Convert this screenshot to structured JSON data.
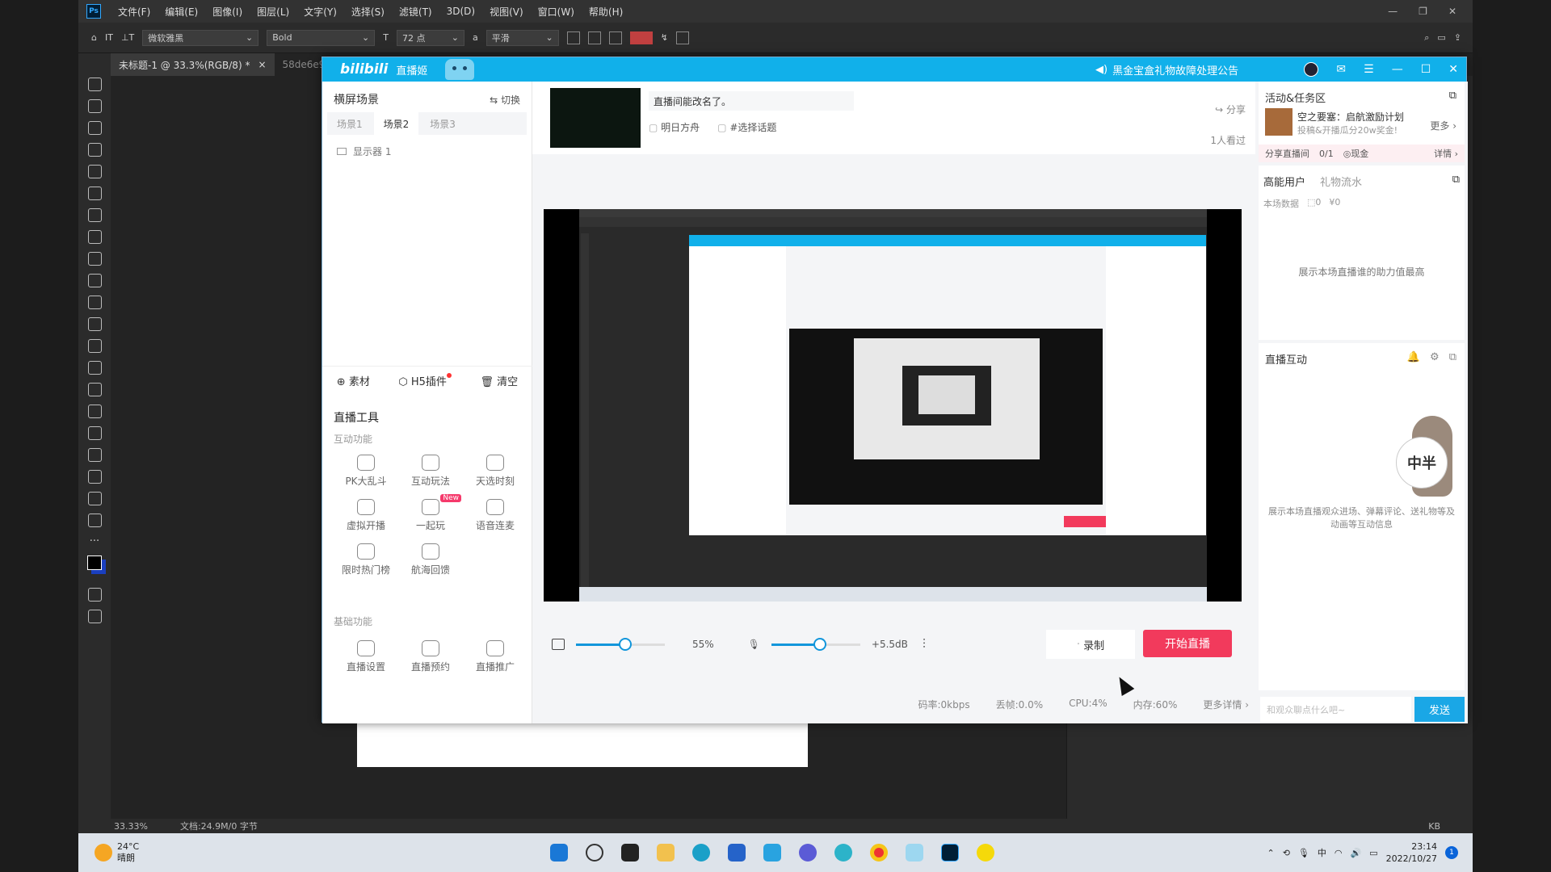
{
  "ps": {
    "menu": [
      "文件(F)",
      "编辑(E)",
      "图像(I)",
      "图层(L)",
      "文字(Y)",
      "选择(S)",
      "滤镜(T)",
      "3D(D)",
      "视图(V)",
      "窗口(W)",
      "帮助(H)"
    ],
    "logo": "Ps",
    "font_family": "微软雅黑",
    "font_style": "Bold",
    "font_size": "72 点",
    "antialias": "平滑",
    "antialias_prefix": "a",
    "text_color": "#c04040",
    "tab_active": "未标题-1 @ 33.3%(RGB/8) *",
    "tab_inactive": "58de6e92",
    "zoom": "33.33%",
    "doc_info": "文档:24.9M/0 字节"
  },
  "bili": {
    "logo": "bilibili",
    "subtitle": "直播姬",
    "notice": "黑金宝盒礼物故障处理公告",
    "scene_header": "横屏场景",
    "switch_label": "切换",
    "scene_tabs": [
      "场景1",
      "场景2",
      "场景3"
    ],
    "display_item": "显示器 1",
    "source_bar": [
      "素材",
      "H5插件",
      "清空"
    ],
    "tools_header": "直播工具",
    "interactive_group": "互动功能",
    "interactive_tools": [
      "PK大乱斗",
      "互动玩法",
      "天选时刻",
      "虚拟开播",
      "一起玩",
      "语音连麦",
      "限时热门榜",
      "航海回馈"
    ],
    "new_badge": "New",
    "basic_group": "基础功能",
    "basic_tools": [
      "直播设置",
      "直播预约",
      "直播推广"
    ],
    "live_title": "直播间能改名了。",
    "tag_area": "明日方舟",
    "tag_topic": "#选择话题",
    "share": "分享",
    "viewers": "1人看过",
    "volume": "55%",
    "mic_gain": "+5.5dB",
    "record": "录制",
    "start_live": "开始直播",
    "stats": [
      "码率:0kbps",
      "丢帧:0.0%",
      "CPU:4%",
      "内存:60%",
      "更多详情"
    ],
    "activity_header": "活动&任务区",
    "activity_title": "空之要塞：启航激励计划",
    "activity_sub": "投稿&开播瓜分20w奖金!",
    "more": "更多",
    "share_room": "分享直播间",
    "share_progress": "0/1",
    "cash": "现金",
    "details": "详情",
    "energy_tab": "高能用户",
    "gift_tab": "礼物流水",
    "session_data": "本场数据",
    "gift_count": "0",
    "yen": "¥0",
    "energy_empty": "展示本场直播谁的助力值最高",
    "interact_header": "直播互动",
    "interact_hint": "展示本场直播观众进场、弹幕评论、送礼物等及动画等互动信息",
    "chat_placeholder": "和观众聊点什么吧~",
    "send": "发送",
    "mascot_text": "中半"
  },
  "taskbar": {
    "temp": "24°C",
    "weather": "晴朗",
    "time": "23:14",
    "date": "2022/10/27",
    "notifications": "1",
    "ps_status_tray": "KB"
  },
  "colors": {
    "bili_blue": "#11b0ea",
    "live_red": "#f23a5c",
    "accent_blue": "#1296db"
  }
}
